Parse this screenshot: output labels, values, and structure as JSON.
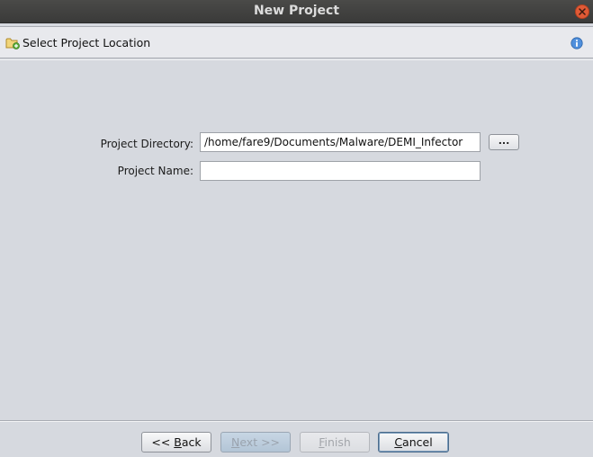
{
  "window": {
    "title": "New Project"
  },
  "header": {
    "label": "Select Project Location",
    "icon": "folder-add-icon",
    "info_icon": "info-icon"
  },
  "form": {
    "project_directory": {
      "label": "Project Directory:",
      "value": "/home/fare9/Documents/Malware/DEMI_Infector"
    },
    "project_name": {
      "label": "Project Name:",
      "value": ""
    },
    "browse_label": "..."
  },
  "buttons": {
    "back_prefix": "<< ",
    "back_mnemonic": "B",
    "back_rest": "ack",
    "next_mnemonic": "N",
    "next_rest": "ext >>",
    "finish_mnemonic": "F",
    "finish_rest": "inish",
    "cancel_mnemonic": "C",
    "cancel_rest": "ancel"
  },
  "colors": {
    "titlebar": "#3f3f3e",
    "close": "#e05a36",
    "background": "#d6d9df",
    "info": "#3f7fd0"
  }
}
